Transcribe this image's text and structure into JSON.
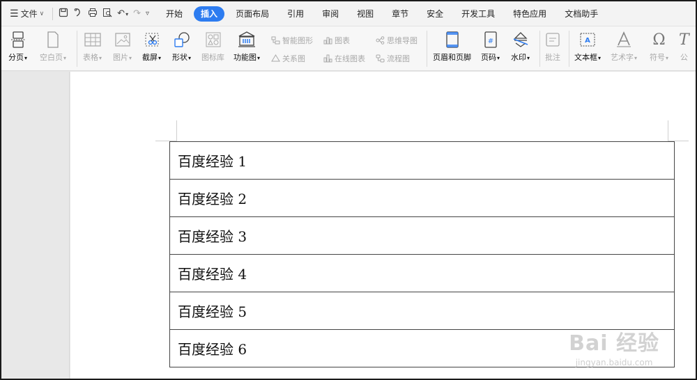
{
  "menubar": {
    "file_label": "文件",
    "tabs": [
      {
        "label": "开始",
        "active": false
      },
      {
        "label": "插入",
        "active": true
      },
      {
        "label": "页面布局",
        "active": false
      },
      {
        "label": "引用",
        "active": false
      },
      {
        "label": "审阅",
        "active": false
      },
      {
        "label": "视图",
        "active": false
      },
      {
        "label": "章节",
        "active": false
      },
      {
        "label": "安全",
        "active": false
      },
      {
        "label": "开发工具",
        "active": false
      },
      {
        "label": "特色应用",
        "active": false
      },
      {
        "label": "文档助手",
        "active": false
      }
    ]
  },
  "ribbon": {
    "page_break": "分页",
    "blank_page": "空白页",
    "table": "表格",
    "picture": "图片",
    "screenshot": "截屏",
    "shape": "形状",
    "icon_library": "图标库",
    "function_chart": "功能图",
    "smart_art": "智能图形",
    "chart": "图表",
    "mind_map": "思维导图",
    "relation_chart": "关系图",
    "online_chart": "在线图表",
    "flowchart": "流程图",
    "header_footer": "页眉和页脚",
    "page_number": "页码",
    "watermark": "水印",
    "comment": "批注",
    "text_box": "文本框",
    "word_art": "艺术字",
    "symbol": "符号",
    "formula": "公"
  },
  "document": {
    "rows": [
      "百度经验 1",
      "百度经验 2",
      "百度经验 3",
      "百度经验 4",
      "百度经验 5",
      "百度经验 6"
    ]
  },
  "watermark": {
    "main": "Bai 经验",
    "sub": "jingyan.baidu.com"
  },
  "colors": {
    "accent": "#2d7cf0",
    "table_border": "#444444",
    "page_bg": "#ffffff",
    "workspace_bg": "#e8e8e8"
  }
}
